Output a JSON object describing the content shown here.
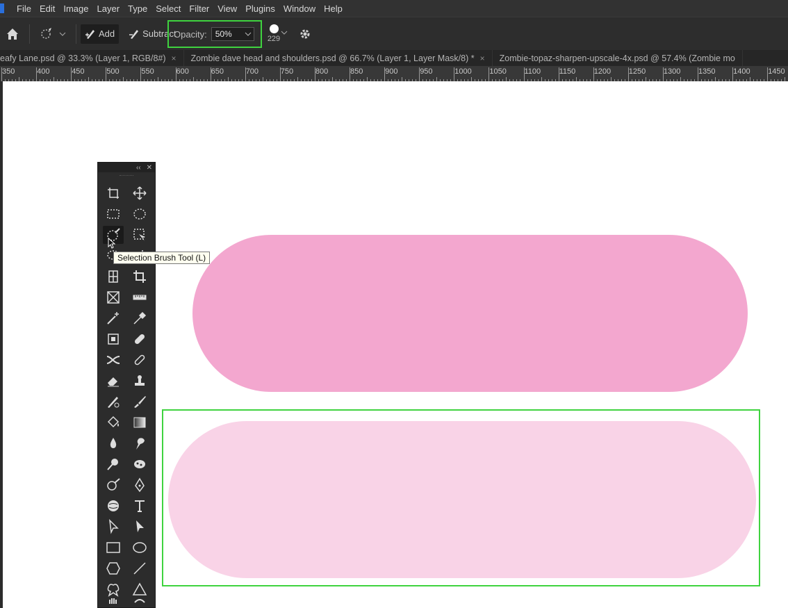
{
  "menu": [
    "File",
    "Edit",
    "Image",
    "Layer",
    "Type",
    "Select",
    "Filter",
    "View",
    "Plugins",
    "Window",
    "Help"
  ],
  "options_bar": {
    "add_label": "Add",
    "subtract_label": "Subtract",
    "opacity_label": "Opacity:",
    "opacity_value": "50%",
    "brush_size": "229"
  },
  "tabs": [
    {
      "title": "eafy Lane.psd @ 33.3% (Layer 1, RGB/8#)",
      "close": "×"
    },
    {
      "title": "Zombie dave head and shoulders.psd @ 66.7% (Layer 1, Layer Mask/8) *",
      "close": "×"
    },
    {
      "title": "Zombie-topaz-sharpen-upscale-4x.psd @ 57.4% (Zombie mo",
      "close": ""
    }
  ],
  "ruler": [
    "350",
    "400",
    "450",
    "500",
    "550",
    "600",
    "650",
    "700",
    "750",
    "800",
    "850",
    "900",
    "950",
    "1000",
    "1050",
    "1100",
    "1150",
    "1200",
    "1250",
    "1300",
    "1350",
    "1400",
    "1450"
  ],
  "tooltip": "Selection Brush Tool (L)",
  "colors": {
    "accent_highlight": "#3fd33f",
    "pill_full_opacity": "#f3a7cf",
    "pill_half_opacity": "#f9d3e7"
  }
}
